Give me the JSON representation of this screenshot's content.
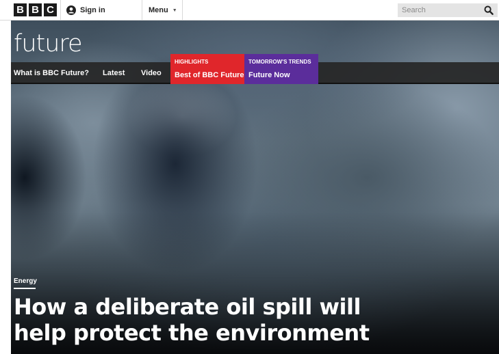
{
  "header": {
    "logo_letters": [
      "B",
      "B",
      "C"
    ],
    "signin_label": "Sign in",
    "menu_label": "Menu",
    "search_placeholder": "Search"
  },
  "site": {
    "title": "future"
  },
  "nav": {
    "links": [
      {
        "label": "What is BBC Future?"
      },
      {
        "label": "Latest"
      },
      {
        "label": "Video"
      }
    ],
    "highlight_box": {
      "kicker": "HIGHLIGHTS",
      "label": "Best of BBC Future",
      "color": "#e0262b"
    },
    "trends_box": {
      "kicker": "TOMORROW'S TRENDS",
      "label": "Future Now",
      "color": "#5b2d9b"
    }
  },
  "article": {
    "tag": "Energy",
    "headline_line1": "How a deliberate oil spill will",
    "headline_line2": "help protect the environment"
  },
  "icons": {
    "signin": "person-icon",
    "menu": "chevron-down-icon",
    "search": "search-icon"
  }
}
